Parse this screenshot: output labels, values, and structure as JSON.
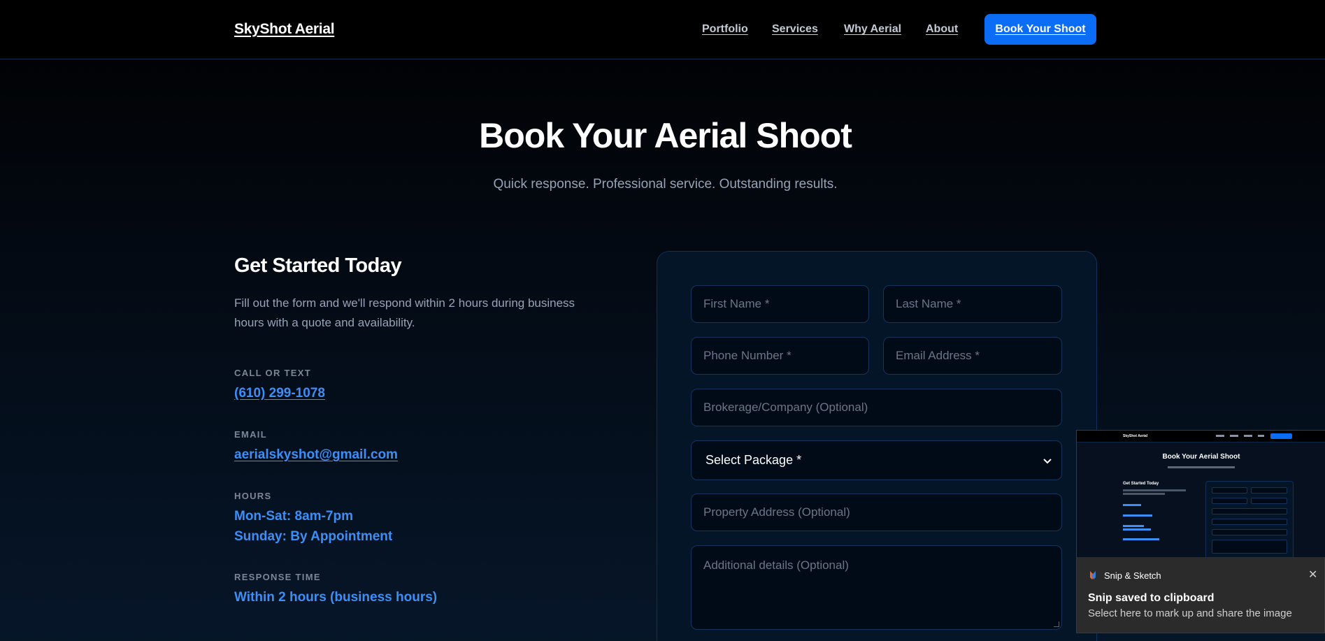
{
  "header": {
    "brand": "SkyShot Aerial",
    "nav": [
      "Portfolio",
      "Services",
      "Why Aerial",
      "About"
    ],
    "cta_label": "Book Your Shoot"
  },
  "hero": {
    "title": "Book Your Aerial Shoot",
    "subtitle": "Quick response. Professional service. Outstanding results."
  },
  "contact": {
    "title": "Get Started Today",
    "description": "Fill out the form and we'll respond within 2 hours during business hours with a quote and availability.",
    "call_label": "CALL OR TEXT",
    "phone": "(610) 299-1078",
    "email_label": "EMAIL",
    "email": "aerialskyshot@gmail.com",
    "hours_label": "HOURS",
    "hours": [
      "Mon-Sat: 8am-7pm",
      "Sunday: By Appointment"
    ],
    "response_label": "RESPONSE TIME",
    "response": "Within 2 hours (business hours)"
  },
  "form": {
    "first_name_placeholder": "First Name *",
    "last_name_placeholder": "Last Name *",
    "phone_placeholder": "Phone Number *",
    "email_placeholder": "Email Address *",
    "company_placeholder": "Brokerage/Company (Optional)",
    "package_selected": "Select Package *",
    "address_placeholder": "Property Address (Optional)",
    "details_placeholder": "Additional details (Optional)"
  },
  "toast": {
    "app_name": "Snip & Sketch",
    "title": "Snip saved to clipboard",
    "message": "Select here to mark up and share the image",
    "thumbnail_brand": "SkyShot Aerial",
    "thumbnail_title": "Book Your Aerial Shoot",
    "thumbnail_left_title": "Get Started Today"
  },
  "colors": {
    "accent": "#0b6cf6",
    "link": "#3d8ef5",
    "background": "#000000",
    "card": "#041528"
  }
}
